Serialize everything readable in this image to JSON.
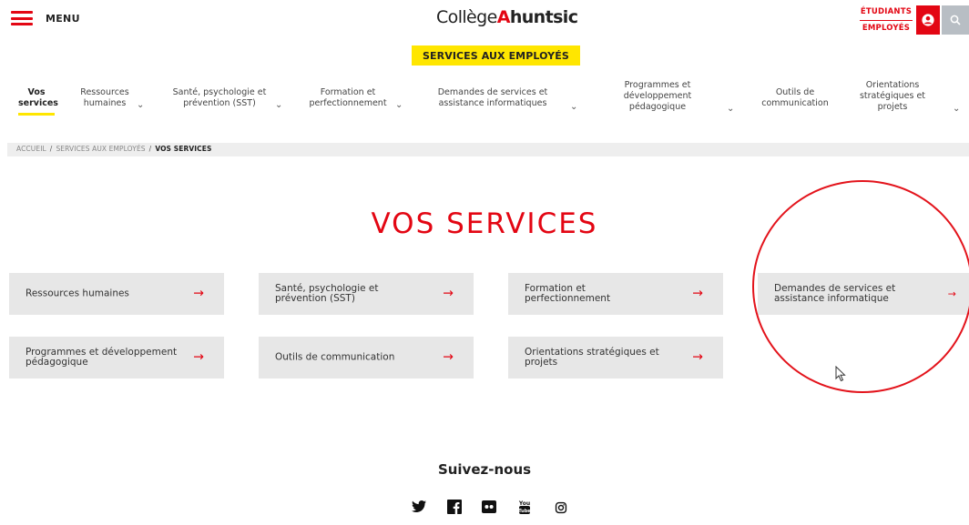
{
  "header": {
    "menu_label": "MENU",
    "logo_prefix": "Collège",
    "logo_accent": "A",
    "logo_suffix": "huntsic",
    "audience_students": "ÉTUDIANTS",
    "audience_employees": "EMPLOYÉS",
    "icons": {
      "menu": "hamburger-icon",
      "user": "user-icon",
      "search": "search-icon"
    }
  },
  "banner": {
    "label": "SERVICES AUX EMPLOYÉS"
  },
  "nav": {
    "items": [
      {
        "label_line1": "Vos",
        "label_line2": "services",
        "label_line3": "",
        "active": true
      },
      {
        "label_line1": "Ressources",
        "label_line2": "humaines",
        "label_line3": "",
        "active": false
      },
      {
        "label_line1": "Santé, psychologie et",
        "label_line2": "prévention (SST)",
        "label_line3": "",
        "active": false
      },
      {
        "label_line1": "Formation et",
        "label_line2": "perfectionnement",
        "label_line3": "",
        "active": false
      },
      {
        "label_line1": "Demandes de services et",
        "label_line2": "assistance informatiques",
        "label_line3": "",
        "active": false
      },
      {
        "label_line1": "Programmes et",
        "label_line2": "développement",
        "label_line3": "pédagogique",
        "active": false
      },
      {
        "label_line1": "Outils de",
        "label_line2": "communication",
        "label_line3": "",
        "active": false
      },
      {
        "label_line1": "Orientations",
        "label_line2": "stratégiques et",
        "label_line3": "projets",
        "active": false
      }
    ]
  },
  "breadcrumb": {
    "home": "ACCUEIL",
    "section": "SERVICES AUX EMPLOYÉS",
    "current": "VOS SERVICES",
    "separator": "/"
  },
  "page": {
    "title": "VOS SERVICES"
  },
  "cards": [
    {
      "line1": "Ressources humaines",
      "line2": ""
    },
    {
      "line1": "Santé, psychologie et",
      "line2": "prévention (SST)"
    },
    {
      "line1": "Formation et",
      "line2": "perfectionnement"
    },
    {
      "line1": "Demandes de services et",
      "line2": "assistance informatique"
    },
    {
      "line1": "Programmes et développement",
      "line2": "pédagogique"
    },
    {
      "line1": "Outils de communication",
      "line2": ""
    },
    {
      "line1": "Orientations stratégiques et",
      "line2": "projets"
    }
  ],
  "footer": {
    "follow_label": "Suivez-nous",
    "socials": [
      "twitter-icon",
      "facebook-icon",
      "flickr-icon",
      "youtube-icon",
      "instagram-icon"
    ]
  },
  "colors": {
    "brand_red": "#e30613",
    "banner_yellow": "#ffe600",
    "card_gray": "#e7e7e7",
    "search_gray": "#b8bec4"
  }
}
